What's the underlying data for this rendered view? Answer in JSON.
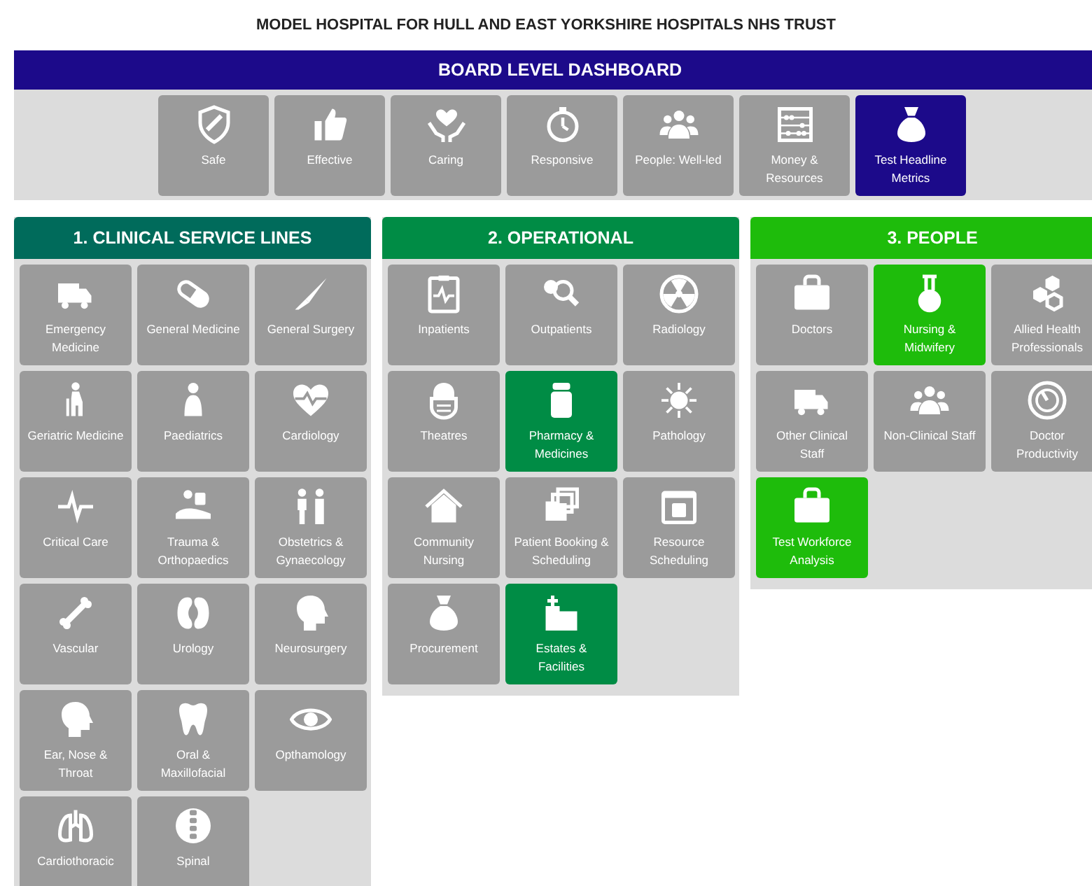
{
  "title": "MODEL HOSPITAL FOR HULL AND EAST YORKSHIRE HOSPITALS NHS TRUST",
  "board": {
    "title": "BOARD LEVEL DASHBOARD",
    "color": "#1c0a8a",
    "tiles": [
      {
        "label": "Safe",
        "highlighted": false
      },
      {
        "label": "Effective",
        "highlighted": false
      },
      {
        "label": "Caring",
        "highlighted": false
      },
      {
        "label": "Responsive",
        "highlighted": false
      },
      {
        "label": "People: Well-led",
        "highlighted": false
      },
      {
        "label": "Money & Resources",
        "highlighted": false
      },
      {
        "label": "Test Headline Metrics",
        "highlighted": true
      }
    ]
  },
  "panels": [
    {
      "title": "1. CLINICAL SERVICE LINES",
      "color": "#006b5b",
      "tiles": [
        {
          "label": "Emergency Medicine",
          "highlighted": false
        },
        {
          "label": "General Medicine",
          "highlighted": false
        },
        {
          "label": "General Surgery",
          "highlighted": false
        },
        {
          "label": "Geriatric Medicine",
          "highlighted": false
        },
        {
          "label": "Paediatrics",
          "highlighted": false
        },
        {
          "label": "Cardiology",
          "highlighted": false
        },
        {
          "label": "Critical Care",
          "highlighted": false
        },
        {
          "label": "Trauma & Orthopaedics",
          "highlighted": false
        },
        {
          "label": "Obstetrics & Gynaecology",
          "highlighted": false
        },
        {
          "label": "Vascular",
          "highlighted": false
        },
        {
          "label": "Urology",
          "highlighted": false
        },
        {
          "label": "Neurosurgery",
          "highlighted": false
        },
        {
          "label": "Ear, Nose & Throat",
          "highlighted": false
        },
        {
          "label": "Oral & Maxillofacial",
          "highlighted": false
        },
        {
          "label": "Opthamology",
          "highlighted": false
        },
        {
          "label": "Cardiothoracic",
          "highlighted": false
        },
        {
          "label": "Spinal",
          "highlighted": false
        }
      ]
    },
    {
      "title": "2. OPERATIONAL",
      "color": "#008c45",
      "tiles": [
        {
          "label": "Inpatients",
          "highlighted": false
        },
        {
          "label": "Outpatients",
          "highlighted": false
        },
        {
          "label": "Radiology",
          "highlighted": false
        },
        {
          "label": "Theatres",
          "highlighted": false
        },
        {
          "label": "Pharmacy & Medicines",
          "highlighted": true
        },
        {
          "label": "Pathology",
          "highlighted": false
        },
        {
          "label": "Community Nursing",
          "highlighted": false
        },
        {
          "label": "Patient Booking & Scheduling",
          "highlighted": false
        },
        {
          "label": "Resource Scheduling",
          "highlighted": false
        },
        {
          "label": "Procurement",
          "highlighted": false
        },
        {
          "label": "Estates & Facilities",
          "highlighted": true
        }
      ]
    },
    {
      "title": "3. PEOPLE",
      "color": "#1ebc0b",
      "tiles": [
        {
          "label": "Doctors",
          "highlighted": false
        },
        {
          "label": "Nursing & Midwifery",
          "highlighted": true
        },
        {
          "label": "Allied Health Professionals",
          "highlighted": false
        },
        {
          "label": "Other Clinical Staff",
          "highlighted": false
        },
        {
          "label": "Non-Clinical Staff",
          "highlighted": false
        },
        {
          "label": "Doctor Productivity",
          "highlighted": false
        },
        {
          "label": "Test Workforce Analysis",
          "highlighted": true
        }
      ]
    }
  ]
}
